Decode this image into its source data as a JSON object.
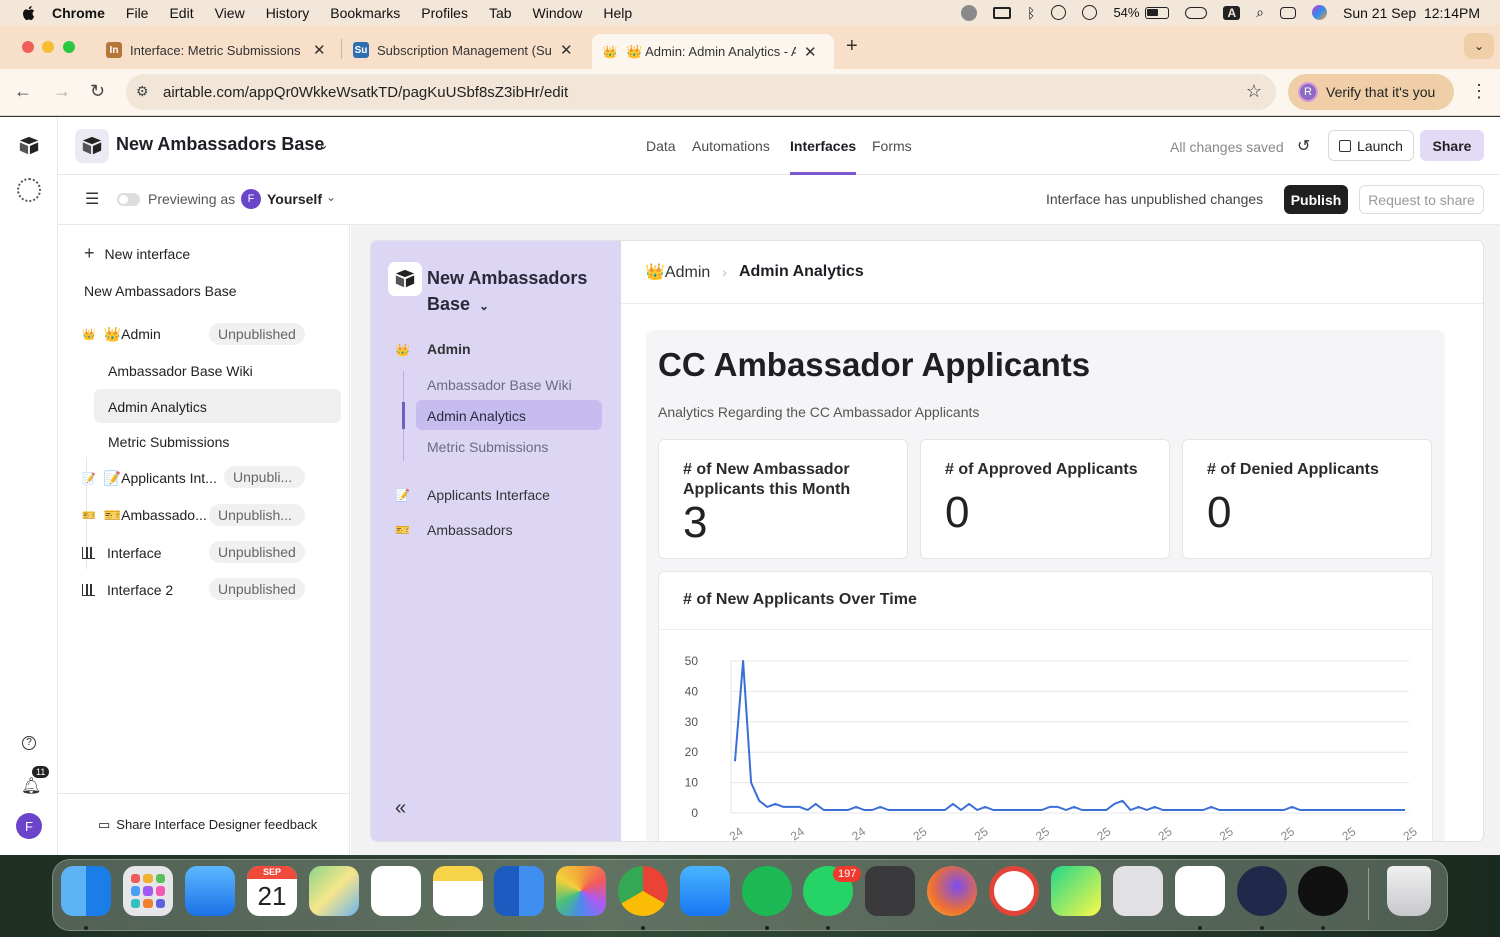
{
  "menubar": {
    "items": [
      "Chrome",
      "File",
      "Edit",
      "View",
      "History",
      "Bookmarks",
      "Profiles",
      "Tab",
      "Window",
      "Help"
    ],
    "battery": "54%",
    "input_source": "A",
    "datetime": "Sun 21 Sep  12:14PM"
  },
  "tabs": [
    {
      "title": "Interface: Metric Submissions",
      "favicon": "In",
      "color": "#b5763a"
    },
    {
      "title": "Subscription Management (Su",
      "favicon": "Su",
      "color": "#2f6fb0"
    },
    {
      "title": "👑 Admin: Admin Analytics - A",
      "favicon": "👑",
      "color": "#f7dfc9",
      "active": true
    }
  ],
  "address": {
    "url": "airtable.com/appQr0WkkeWsatkTD/pagKuUSbf8sZ3ibHr/edit",
    "verify": "Verify that it's you",
    "verify_avatar": "R"
  },
  "header": {
    "base_name": "New Ambassadors Base",
    "nav": [
      "Data",
      "Automations",
      "Interfaces",
      "Forms"
    ],
    "active_nav": "Interfaces",
    "saved": "All changes saved",
    "launch": "Launch",
    "share": "Share"
  },
  "subbar": {
    "previewing": "Previewing as",
    "avatar": "F",
    "user": "Yourself",
    "unpublished_msg": "Interface has unpublished changes",
    "publish": "Publish",
    "request": "Request to share"
  },
  "sidebar": {
    "new_interface": "New interface",
    "base_label": "New Ambassadors Base",
    "groups": [
      {
        "icon": "👑",
        "label": "👑Admin",
        "badge": "Unpublished"
      },
      {
        "icon": "📝",
        "label": "📝Applicants Int...",
        "badge": "Unpubli..."
      },
      {
        "icon": "🎫",
        "label": "🎫Ambassado...",
        "badge": "Unpublish..."
      },
      {
        "icon": "bar-chart",
        "label": "Interface",
        "badge": "Unpublished"
      },
      {
        "icon": "bar-chart",
        "label": "Interface 2",
        "badge": "Unpublished"
      }
    ],
    "admin_pages": [
      "Ambassador Base Wiki",
      "Admin Analytics",
      "Metric Submissions"
    ],
    "feedback": "Share Interface Designer feedback"
  },
  "rail": {
    "notifications": "11",
    "avatar": "F"
  },
  "interface_panel": {
    "title": "New Ambassadors Base",
    "group": "Admin",
    "group_icon": "👑",
    "pages": [
      "Ambassador Base Wiki",
      "Admin Analytics",
      "Metric Submissions"
    ],
    "other": [
      {
        "icon": "📝",
        "label": "Applicants Interface"
      },
      {
        "icon": "🎫",
        "label": "Ambassadors"
      }
    ]
  },
  "breadcrumb": {
    "parent": "👑Admin",
    "current": "Admin Analytics"
  },
  "page": {
    "title": "CC Ambassador Applicants",
    "description": "Analytics Regarding the CC Ambassador Applicants",
    "stats": [
      {
        "label": "# of New Ambassador Applicants this Month",
        "value": "3"
      },
      {
        "label": "# of Approved Applicants",
        "value": "0"
      },
      {
        "label": "# of Denied Applicants",
        "value": "0"
      }
    ],
    "chart_title": "# of New Applicants Over Time"
  },
  "chart_data": {
    "type": "line",
    "title": "# of New Applicants Over Time",
    "yticks": [
      "50",
      "40",
      "30",
      "20",
      "10",
      "0"
    ],
    "ylim": [
      0,
      50
    ],
    "xtick_labels": [
      "24",
      "24",
      "24",
      "25",
      "25",
      "25",
      "25",
      "25",
      "25",
      "25",
      "25",
      "25"
    ],
    "color": "#3b6fd8",
    "values": [
      17,
      50,
      10,
      4,
      2,
      3,
      2,
      2,
      2,
      1,
      3,
      1,
      1,
      1,
      1,
      2,
      1,
      1,
      2,
      1,
      1,
      1,
      1,
      1,
      1,
      1,
      1,
      3,
      1,
      3,
      1,
      2,
      1,
      1,
      1,
      1,
      1,
      1,
      1,
      2,
      2,
      1,
      2,
      1,
      1,
      1,
      1,
      3,
      4,
      1,
      2,
      1,
      2,
      1,
      1,
      1,
      1,
      1,
      1,
      2,
      1,
      1,
      1,
      1,
      1,
      1,
      1,
      1,
      1,
      2,
      1,
      1,
      1,
      1,
      1,
      1,
      1,
      1,
      1,
      1,
      1,
      1,
      1,
      1
    ]
  },
  "dock": {
    "calendar_month": "SEP",
    "calendar_day": "21",
    "whatsapp_badge": "197"
  },
  "colors": {
    "accent": "#7a57d1",
    "panel": "#dcd6f4"
  }
}
